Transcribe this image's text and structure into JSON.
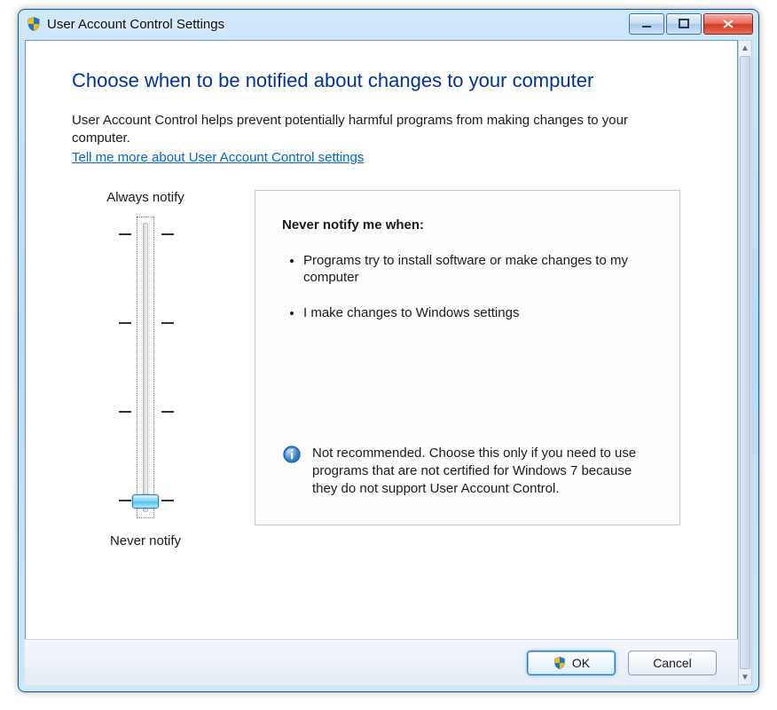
{
  "window": {
    "title": "User Account Control Settings"
  },
  "page": {
    "heading": "Choose when to be notified about changes to your computer",
    "intro": "User Account Control helps prevent potentially harmful programs from making changes to your computer.",
    "help_link": "Tell me more about User Account Control settings"
  },
  "slider": {
    "top_label": "Always notify",
    "bottom_label": "Never notify",
    "levels": 4,
    "current_level_index": 3,
    "current_level_key": "never_notify"
  },
  "description": {
    "title": "Never notify me when:",
    "bullets": [
      "Programs try to install software or make changes to my computer",
      "I make changes to Windows settings"
    ],
    "warning": "Not recommended. Choose this only if you need to use programs that are not certified for Windows 7 because they do not support User Account Control."
  },
  "footer": {
    "ok_label": "OK",
    "cancel_label": "Cancel"
  }
}
